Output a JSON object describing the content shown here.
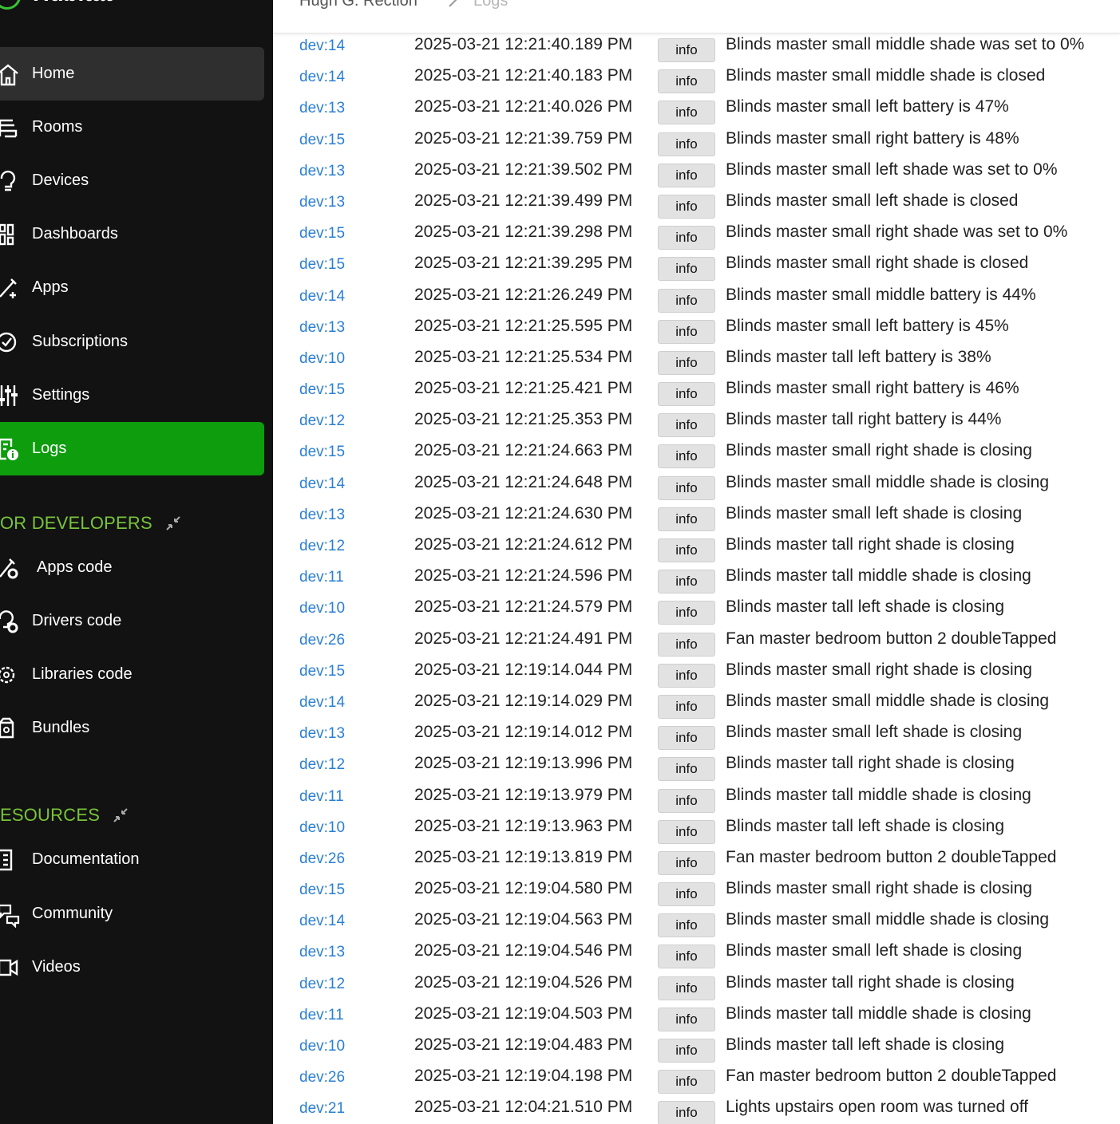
{
  "brand": {
    "name": "Hubitat"
  },
  "breadcrumb": {
    "items": [
      "Hugh G. Rection",
      "Logs"
    ]
  },
  "sidebar": {
    "main_items": [
      {
        "label": "Home",
        "icon": "home-icon"
      },
      {
        "label": "Rooms",
        "icon": "rooms-icon"
      },
      {
        "label": "Devices",
        "icon": "devices-icon"
      },
      {
        "label": "Dashboards",
        "icon": "dashboards-icon"
      },
      {
        "label": "Apps",
        "icon": "apps-icon"
      },
      {
        "label": "Subscriptions",
        "icon": "subscriptions-icon"
      },
      {
        "label": "Settings",
        "icon": "settings-icon"
      },
      {
        "label": "Logs",
        "icon": "logs-icon"
      }
    ],
    "developers": {
      "title": "OR DEVELOPERS",
      "items": [
        {
          "label": "Apps code",
          "icon": "apps-code-icon"
        },
        {
          "label": "Drivers code",
          "icon": "drivers-code-icon"
        },
        {
          "label": "Libraries code",
          "icon": "libraries-code-icon"
        },
        {
          "label": "Bundles",
          "icon": "bundles-icon"
        }
      ]
    },
    "resources": {
      "title": "ESOURCES",
      "items": [
        {
          "label": "Documentation",
          "icon": "documentation-icon"
        },
        {
          "label": "Community",
          "icon": "community-icon"
        },
        {
          "label": "Videos",
          "icon": "videos-icon"
        }
      ]
    }
  },
  "colors": {
    "accent_green": "#0d9d0d",
    "section_green": "#78c43a",
    "link_blue": "#2a7fd4"
  },
  "logs": [
    {
      "dev": "dev:14",
      "time": "2025-03-21 12:21:40.189 PM",
      "level": "info",
      "msg": "Blinds master small middle shade was set to 0%"
    },
    {
      "dev": "dev:14",
      "time": "2025-03-21 12:21:40.183 PM",
      "level": "info",
      "msg": "Blinds master small middle shade is closed"
    },
    {
      "dev": "dev:13",
      "time": "2025-03-21 12:21:40.026 PM",
      "level": "info",
      "msg": "Blinds master small left battery is 47%"
    },
    {
      "dev": "dev:15",
      "time": "2025-03-21 12:21:39.759 PM",
      "level": "info",
      "msg": "Blinds master small right battery is 48%"
    },
    {
      "dev": "dev:13",
      "time": "2025-03-21 12:21:39.502 PM",
      "level": "info",
      "msg": "Blinds master small left shade was set to 0%"
    },
    {
      "dev": "dev:13",
      "time": "2025-03-21 12:21:39.499 PM",
      "level": "info",
      "msg": "Blinds master small left shade is closed"
    },
    {
      "dev": "dev:15",
      "time": "2025-03-21 12:21:39.298 PM",
      "level": "info",
      "msg": "Blinds master small right shade was set to 0%"
    },
    {
      "dev": "dev:15",
      "time": "2025-03-21 12:21:39.295 PM",
      "level": "info",
      "msg": "Blinds master small right shade is closed"
    },
    {
      "dev": "dev:14",
      "time": "2025-03-21 12:21:26.249 PM",
      "level": "info",
      "msg": "Blinds master small middle battery is 44%"
    },
    {
      "dev": "dev:13",
      "time": "2025-03-21 12:21:25.595 PM",
      "level": "info",
      "msg": "Blinds master small left battery is 45%"
    },
    {
      "dev": "dev:10",
      "time": "2025-03-21 12:21:25.534 PM",
      "level": "info",
      "msg": "Blinds master tall left battery is 38%"
    },
    {
      "dev": "dev:15",
      "time": "2025-03-21 12:21:25.421 PM",
      "level": "info",
      "msg": "Blinds master small right battery is 46%"
    },
    {
      "dev": "dev:12",
      "time": "2025-03-21 12:21:25.353 PM",
      "level": "info",
      "msg": "Blinds master tall right battery is 44%"
    },
    {
      "dev": "dev:15",
      "time": "2025-03-21 12:21:24.663 PM",
      "level": "info",
      "msg": "Blinds master small right shade is closing"
    },
    {
      "dev": "dev:14",
      "time": "2025-03-21 12:21:24.648 PM",
      "level": "info",
      "msg": "Blinds master small middle shade is closing"
    },
    {
      "dev": "dev:13",
      "time": "2025-03-21 12:21:24.630 PM",
      "level": "info",
      "msg": "Blinds master small left shade is closing"
    },
    {
      "dev": "dev:12",
      "time": "2025-03-21 12:21:24.612 PM",
      "level": "info",
      "msg": "Blinds master tall right shade is closing"
    },
    {
      "dev": "dev:11",
      "time": "2025-03-21 12:21:24.596 PM",
      "level": "info",
      "msg": "Blinds master tall middle shade is closing"
    },
    {
      "dev": "dev:10",
      "time": "2025-03-21 12:21:24.579 PM",
      "level": "info",
      "msg": "Blinds master tall left shade is closing"
    },
    {
      "dev": "dev:26",
      "time": "2025-03-21 12:21:24.491 PM",
      "level": "info",
      "msg": "Fan master bedroom button 2 doubleTapped"
    },
    {
      "dev": "dev:15",
      "time": "2025-03-21 12:19:14.044 PM",
      "level": "info",
      "msg": "Blinds master small right shade is closing"
    },
    {
      "dev": "dev:14",
      "time": "2025-03-21 12:19:14.029 PM",
      "level": "info",
      "msg": "Blinds master small middle shade is closing"
    },
    {
      "dev": "dev:13",
      "time": "2025-03-21 12:19:14.012 PM",
      "level": "info",
      "msg": "Blinds master small left shade is closing"
    },
    {
      "dev": "dev:12",
      "time": "2025-03-21 12:19:13.996 PM",
      "level": "info",
      "msg": "Blinds master tall right shade is closing"
    },
    {
      "dev": "dev:11",
      "time": "2025-03-21 12:19:13.979 PM",
      "level": "info",
      "msg": "Blinds master tall middle shade is closing"
    },
    {
      "dev": "dev:10",
      "time": "2025-03-21 12:19:13.963 PM",
      "level": "info",
      "msg": "Blinds master tall left shade is closing"
    },
    {
      "dev": "dev:26",
      "time": "2025-03-21 12:19:13.819 PM",
      "level": "info",
      "msg": "Fan master bedroom button 2 doubleTapped"
    },
    {
      "dev": "dev:15",
      "time": "2025-03-21 12:19:04.580 PM",
      "level": "info",
      "msg": "Blinds master small right shade is closing"
    },
    {
      "dev": "dev:14",
      "time": "2025-03-21 12:19:04.563 PM",
      "level": "info",
      "msg": "Blinds master small middle shade is closing"
    },
    {
      "dev": "dev:13",
      "time": "2025-03-21 12:19:04.546 PM",
      "level": "info",
      "msg": "Blinds master small left shade is closing"
    },
    {
      "dev": "dev:12",
      "time": "2025-03-21 12:19:04.526 PM",
      "level": "info",
      "msg": "Blinds master tall right shade is closing"
    },
    {
      "dev": "dev:11",
      "time": "2025-03-21 12:19:04.503 PM",
      "level": "info",
      "msg": "Blinds master tall middle shade is closing"
    },
    {
      "dev": "dev:10",
      "time": "2025-03-21 12:19:04.483 PM",
      "level": "info",
      "msg": "Blinds master tall left shade is closing"
    },
    {
      "dev": "dev:26",
      "time": "2025-03-21 12:19:04.198 PM",
      "level": "info",
      "msg": "Fan master bedroom button 2 doubleTapped"
    },
    {
      "dev": "dev:21",
      "time": "2025-03-21 12:04:21.510 PM",
      "level": "info",
      "msg": "Lights upstairs open room was turned off"
    }
  ]
}
